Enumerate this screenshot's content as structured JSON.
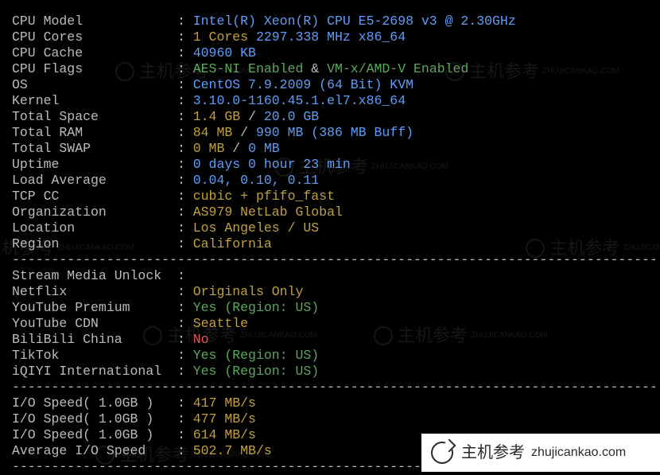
{
  "divider": "----------------------------------------------------------------------------------",
  "sys": {
    "cpu_model": {
      "label": "CPU Model",
      "value": "Intel(R) Xeon(R) CPU E5-2698 v3 @ 2.30GHz"
    },
    "cpu_cores": {
      "label": "CPU Cores",
      "count": "1 Cores ",
      "freq": "2297.338 MHz",
      "arch": " x86_64"
    },
    "cpu_cache": {
      "label": "CPU Cache",
      "value": "40960 KB"
    },
    "cpu_flags": {
      "label": "CPU Flags",
      "aes": "AES-NI Enabled",
      "sep": " & ",
      "vmx": "VM-x/AMD-V Enabled"
    },
    "os": {
      "label": "OS",
      "name": "CentOS 7.9.2009 (64 Bit) ",
      "virt": "KVM"
    },
    "kernel": {
      "label": "Kernel",
      "value": "3.10.0-1160.45.1.el7.x86_64"
    },
    "total_space": {
      "label": "Total Space",
      "used": "1.4 GB",
      "sep": " / ",
      "total": "20.0 GB"
    },
    "total_ram": {
      "label": "Total RAM",
      "used": "84 MB",
      "sep": " / ",
      "total": "990 MB",
      "buff": " (386 MB Buff)"
    },
    "total_swap": {
      "label": "Total SWAP",
      "used": "0 MB",
      "sep": " / ",
      "total": "0 MB"
    },
    "uptime": {
      "label": "Uptime",
      "value": "0 days 0 hour 23 min"
    },
    "load": {
      "label": "Load Average",
      "value": "0.04, 0.10, 0.11"
    },
    "tcp": {
      "label": "TCP CC",
      "value": "cubic + pfifo_fast"
    },
    "org": {
      "label": "Organization",
      "value": "AS979 NetLab Global"
    },
    "location": {
      "label": "Location",
      "value": "Los Angeles / US"
    },
    "region": {
      "label": "Region",
      "value": "California"
    }
  },
  "media": {
    "header": "Stream Media Unlock",
    "netflix": {
      "label": "Netflix",
      "value": "Originals Only"
    },
    "ytp": {
      "label": "YouTube Premium",
      "value": "Yes (Region: US)"
    },
    "ytcdn": {
      "label": "YouTube CDN",
      "value": "Seattle"
    },
    "bili": {
      "label": "BiliBili China",
      "value": "No"
    },
    "tiktok": {
      "label": "TikTok",
      "value": "Yes (Region: US)"
    },
    "iqiyi": {
      "label": "iQIYI International",
      "value": "Yes (Region: US)"
    }
  },
  "io": {
    "t1": {
      "label": "I/O Speed( 1.0GB )",
      "value": "417 MB/s"
    },
    "t2": {
      "label": "I/O Speed( 1.0GB )",
      "value": "477 MB/s"
    },
    "t3": {
      "label": "I/O Speed( 1.0GB )",
      "value": "614 MB/s"
    },
    "avg": {
      "label": "Average I/O Speed",
      "value": "502.7 MB/s"
    }
  },
  "watermark": {
    "name": "主机参考",
    "url": "zhujicankao.com",
    "url_upper": "ZHUJICANKAO.COM"
  }
}
